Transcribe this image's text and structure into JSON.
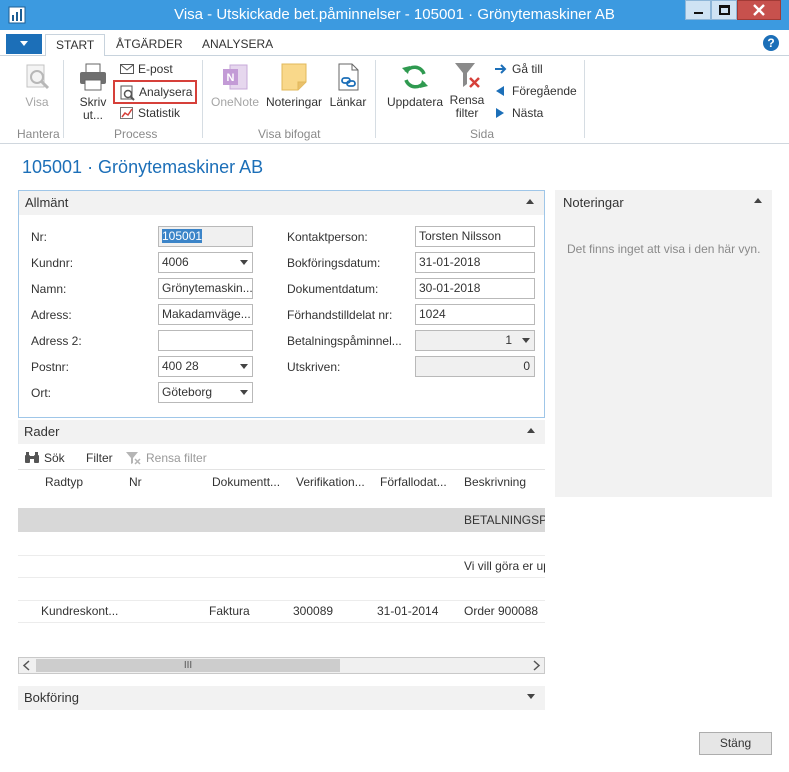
{
  "window": {
    "title": "Visa - Utskickade bet.påminnelser - 105001 · Grönytemaskiner AB"
  },
  "tabs": [
    {
      "label": "START"
    },
    {
      "label": "ÅTGÄRDER"
    },
    {
      "label": "ANALYSERA"
    }
  ],
  "help_label": "?",
  "ribbon": {
    "visa": "Visa",
    "skriv_ut": [
      "Skriv",
      "ut..."
    ],
    "epost": "E-post",
    "analysera": "Analysera",
    "statistik": "Statistik",
    "onenote": "OneNote",
    "noteringar": "Noteringar",
    "lankar": "Länkar",
    "uppdatera": "Uppdatera",
    "rensa_filter": [
      "Rensa",
      "filter"
    ],
    "ga_till": "Gå till",
    "foregaende": "Föregående",
    "nasta": "Nästa",
    "groups": {
      "hantera": "Hantera",
      "process": "Process",
      "visa_bifogat": "Visa bifogat",
      "sida": "Sida"
    }
  },
  "page_title": "105001 · Grönytemaskiner AB",
  "allmant": {
    "header": "Allmänt",
    "left": [
      {
        "label": "Nr:",
        "value": "105001"
      },
      {
        "label": "Kundnr:",
        "value": "4006"
      },
      {
        "label": "Namn:",
        "value": "Grönytemaskin..."
      },
      {
        "label": "Adress:",
        "value": "Makadamväge..."
      },
      {
        "label": "Adress 2:",
        "value": ""
      },
      {
        "label": "Postnr:",
        "value": "400 28"
      },
      {
        "label": "Ort:",
        "value": "Göteborg"
      }
    ],
    "right": [
      {
        "label": "Kontaktperson:",
        "value": "Torsten Nilsson"
      },
      {
        "label": "Bokföringsdatum:",
        "value": "31-01-2018"
      },
      {
        "label": "Dokumentdatum:",
        "value": "30-01-2018"
      },
      {
        "label": "Förhandstilldelat nr:",
        "value": "1024"
      },
      {
        "label": "Betalningspåminnel...",
        "value": "1"
      },
      {
        "label": "Utskriven:",
        "value": "0"
      }
    ]
  },
  "noteringar": {
    "header": "Noteringar",
    "empty": "Det finns inget att visa i den här vyn."
  },
  "rader": {
    "header": "Rader",
    "toolbar": {
      "sok": "Sök",
      "filter": "Filter",
      "rensa_filter": "Rensa filter"
    },
    "columns": [
      "Radtyp",
      "Nr",
      "Dokumentt...",
      "Verifikation...",
      "Förfallodat...",
      "Beskrivning"
    ],
    "rows": [
      {
        "radtyp": "",
        "nr": "",
        "dok": "",
        "ver": "",
        "forf": "",
        "beskr": "BETALNINGSPÅ"
      },
      {
        "radtyp": "",
        "nr": "",
        "dok": "",
        "ver": "",
        "forf": "",
        "beskr": ""
      },
      {
        "radtyp": "",
        "nr": "",
        "dok": "",
        "ver": "",
        "forf": "",
        "beskr": "Vi vill göra er up"
      },
      {
        "radtyp": "",
        "nr": "",
        "dok": "",
        "ver": "",
        "forf": "",
        "beskr": ""
      },
      {
        "radtyp": "Kundreskont...",
        "nr": "",
        "dok": "Faktura",
        "ver": "300089",
        "forf": "31-01-2014",
        "beskr": "Order 900088"
      }
    ]
  },
  "scrollbar_thumb": "III",
  "bokforing": {
    "header": "Bokföring"
  },
  "stang": "Stäng"
}
